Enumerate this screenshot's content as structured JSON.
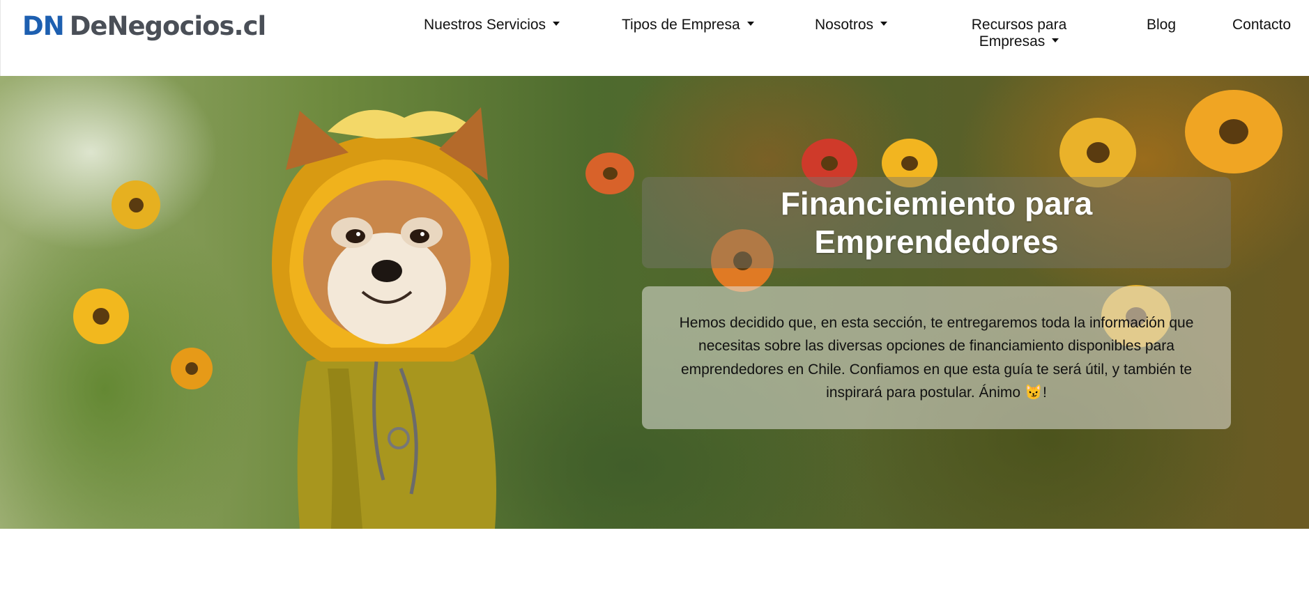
{
  "logo": {
    "mark": "DN",
    "text": "DeNegocios.cl"
  },
  "nav": {
    "items": [
      {
        "label": "Nuestros Servicios",
        "has_dropdown": true
      },
      {
        "label": "Tipos de Empresa",
        "has_dropdown": true
      },
      {
        "label": "Nosotros",
        "has_dropdown": true
      },
      {
        "label_line1": "Recursos para",
        "label_line2": "Empresas",
        "has_dropdown": true
      },
      {
        "label": "Blog",
        "has_dropdown": false
      },
      {
        "label": "Contacto",
        "has_dropdown": false
      }
    ]
  },
  "hero": {
    "title_line1": "Financiemiento para",
    "title_line2": "Emprendedores",
    "description": "Hemos decidido que, en esta sección, te entregaremos toda la información que necesitas sobre las diversas opciones de financiamiento disponibles para emprendedores en Chile. Confiamos en que esta guía te será útil, y también te inspirará para postular. Ánimo 😼!",
    "image_subject": "shiba-inu-in-yellow-hooded-raincoat-among-flowers"
  },
  "colors": {
    "brand_blue": "#1d5fb0",
    "logo_gray": "#4a4f57",
    "title_text": "#ffffff"
  }
}
